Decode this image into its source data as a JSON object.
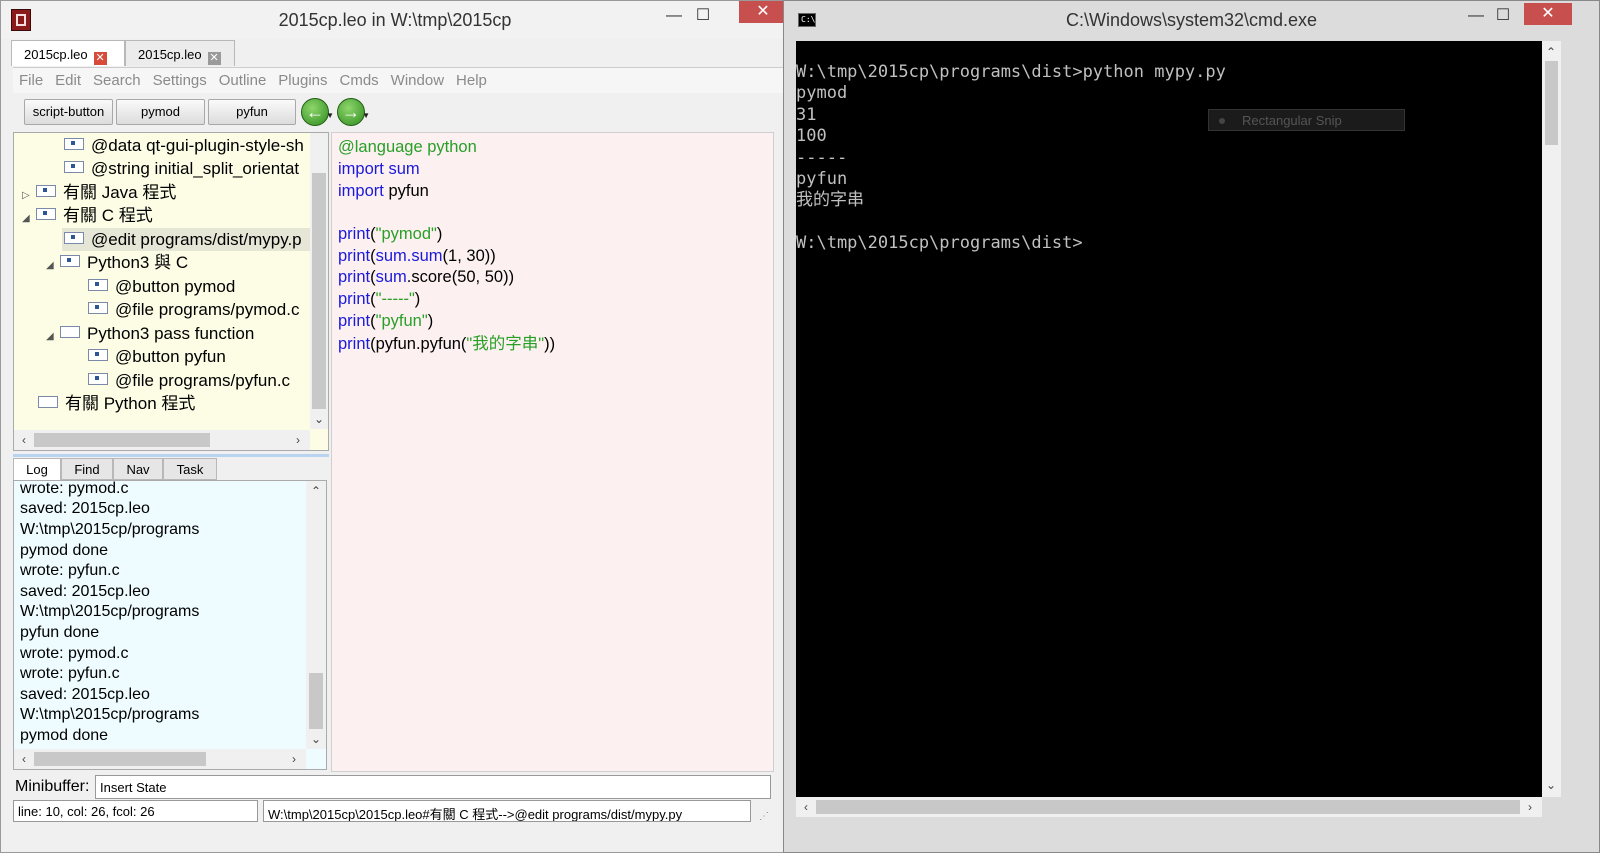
{
  "leo": {
    "title": "2015cp.leo in W:\\tmp\\2015cp",
    "window_buttons": {
      "minimize": "—",
      "maximize": "☐",
      "close": "✕"
    },
    "tabs": [
      {
        "label": "2015cp.leo",
        "active": true
      },
      {
        "label": "2015cp.leo",
        "active": false
      }
    ],
    "menu": [
      "File",
      "Edit",
      "Search",
      "Settings",
      "Outline",
      "Plugins",
      "Cmds",
      "Window",
      "Help"
    ],
    "toolbar_buttons": [
      "script-button",
      "pymod",
      "pyfun"
    ],
    "nav": {
      "back_icon": "back-arrow-icon",
      "forward_icon": "forward-arrow-icon"
    },
    "outline": [
      {
        "label": "@data qt-gui-plugin-style-sh",
        "arrow": "",
        "marked": true
      },
      {
        "label": "@string initial_split_orientat",
        "arrow": "",
        "marked": true
      },
      {
        "label": "有關 Java 程式",
        "arrow": "▷",
        "marked": true
      },
      {
        "label": "有關 C 程式",
        "arrow": "◢",
        "marked": true
      },
      {
        "label": "@edit programs/dist/mypy.p",
        "arrow": "",
        "marked": true,
        "selected": true
      },
      {
        "label": "Python3 與 C",
        "arrow": "◢",
        "marked": true
      },
      {
        "label": "@button pymod",
        "arrow": "",
        "marked": true
      },
      {
        "label": "@file programs/pymod.c",
        "arrow": "",
        "marked": true
      },
      {
        "label": "Python3 pass function",
        "arrow": "◢",
        "marked": false
      },
      {
        "label": "@button pyfun",
        "arrow": "",
        "marked": true
      },
      {
        "label": "@file programs/pyfun.c",
        "arrow": "",
        "marked": true
      },
      {
        "label": "有關 Python 程式",
        "arrow": "",
        "marked": false
      }
    ],
    "log_tabs": [
      "Log",
      "Find",
      "Nav",
      "Task"
    ],
    "log_lines": [
      "wrote: pymod.c",
      "saved: 2015cp.leo",
      "W:\\tmp\\2015cp/programs",
      "pymod done",
      "wrote: pyfun.c",
      "saved: 2015cp.leo",
      "W:\\tmp\\2015cp/programs",
      "pyfun done",
      "wrote: pymod.c",
      "wrote: pyfun.c",
      "saved: 2015cp.leo",
      "W:\\tmp\\2015cp/programs",
      "pymod done"
    ],
    "body": {
      "directive": "@language python",
      "import1_kw": "import",
      "import1_mod": "sum",
      "import2_kw": "import",
      "import2_mod": "pyfun",
      "print_kw": "print",
      "l1_arg": "\"pymod\"",
      "l2_obj": "sum",
      "l2_fn": ".sum",
      "l2_args": "(1, 30)",
      "l3_obj": "sum",
      "l3_rest": ".score(50, 50)",
      "l4_arg": "\"-----\"",
      "l5_arg": "\"pyfun\"",
      "l6_call": "(pyfun.pyfun(",
      "l6_arg": "\"我的字串\"",
      "l6_close": "))"
    },
    "minibuffer_label": "Minibuffer:",
    "minibuffer_value": "Insert State",
    "status_position": "line: 10, col: 26, fcol: 26",
    "status_path": "W:\\tmp\\2015cp\\2015cp.leo#有關 C 程式-->@edit programs/dist/mypy.py"
  },
  "cmd": {
    "title": "C:\\Windows\\system32\\cmd.exe",
    "icon_text": "C:\\",
    "lines": [
      "",
      "W:\\tmp\\2015cp\\programs\\dist>python mypy.py",
      "pymod",
      "31",
      "100",
      "-----",
      "pyfun",
      "我的字串",
      "",
      "W:\\tmp\\2015cp\\programs\\dist>"
    ],
    "overlay": "Rectangular Snip"
  },
  "colors": {
    "keyword": "#1a1adb",
    "string": "#28a028",
    "close_button": "#c7504f",
    "outline_bg": "#fdfde6",
    "body_bg": "#fdf0f0",
    "log_bg": "#eefcff"
  }
}
